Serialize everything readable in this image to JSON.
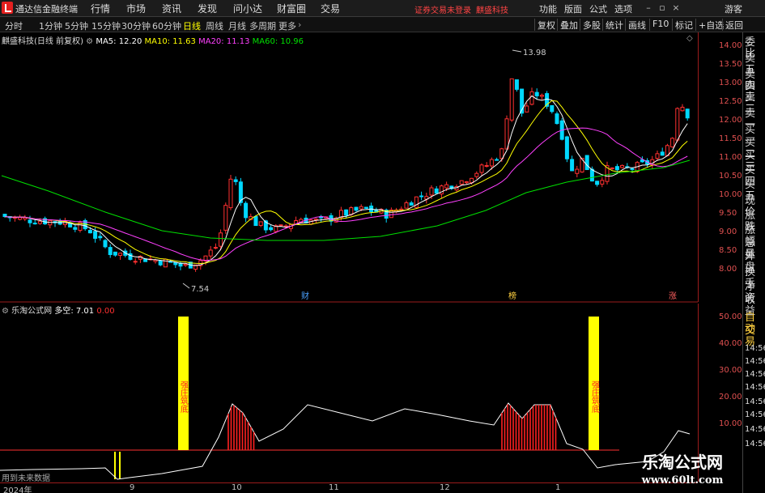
{
  "titlebar": {
    "app_title": "通达信金融终端",
    "menu": [
      "行情",
      "市场",
      "资讯",
      "发现",
      "问小达",
      "财富圈",
      "交易"
    ],
    "login_status": "证券交易未登录",
    "stock": "麒盛科技",
    "right_menu": [
      "功能",
      "版面",
      "公式",
      "选项",
      "游客"
    ],
    "window_buttons": [
      "minimize-icon",
      "restore-icon",
      "close-icon"
    ]
  },
  "toolbar": {
    "periods": [
      "分时",
      "1分钟",
      "5分钟",
      "15分钟",
      "30分钟",
      "60分钟",
      "日线",
      "周线",
      "月线",
      "多周期",
      "更多"
    ],
    "active_period": "日线",
    "right_tools": [
      "复权",
      "叠加",
      "多股",
      "统计",
      "画线",
      "F10",
      "标记",
      "+自选",
      "返回"
    ]
  },
  "chart": {
    "stock_label": "麒盛科技(日线 前复权)",
    "ma": [
      {
        "label": "MA5: 12.20",
        "color": "#ffffff"
      },
      {
        "label": "MA10: 11.63",
        "color": "#ffff00"
      },
      {
        "label": "MA20: 11.13",
        "color": "#ff40ff"
      },
      {
        "label": "MA60: 10.96",
        "color": "#00e000"
      }
    ],
    "high_label": "13.98",
    "low_label": "7.54",
    "markers": [
      "财",
      "榜",
      "涨"
    ],
    "price_ticks": [
      "14.00",
      "13.50",
      "13.00",
      "12.50",
      "12.00",
      "11.50",
      "11.00",
      "10.50",
      "10.00",
      "9.50",
      "9.00",
      "8.50",
      "8.00"
    ]
  },
  "indicator": {
    "title": "乐淘公式网",
    "line_label": "多空: 7.01",
    "zero_label": "0.00",
    "signal_text": "强庄筑底",
    "ticks": [
      "50.00",
      "40.00",
      "30.00",
      "20.00",
      "10.00"
    ],
    "note": "用到未来数据"
  },
  "dates": [
    "2024年",
    "9",
    "10",
    "11",
    "12",
    "1"
  ],
  "sidebar": [
    "委比",
    "卖五",
    "卖四",
    "卖三",
    "卖二",
    "卖一",
    "买一",
    "买二",
    "买三",
    "买四",
    "买五",
    "现价",
    "涨跌",
    "涨幅",
    "总量",
    "外盘",
    "换手",
    "净资",
    "收益",
    "自动",
    "交易",
    "14:56",
    "14:56",
    "14:56",
    "14:56",
    "14:56",
    "14:56",
    "14:56",
    "14:56"
  ],
  "watermark": {
    "line1": "乐淘公式网",
    "line2": "www.60lt.com"
  },
  "colors": {
    "up": "#ff3030",
    "down": "#00d8ff",
    "ma5": "#ffffff",
    "ma10": "#ffff00",
    "ma20": "#ff40ff",
    "ma60": "#00e000",
    "signal": "#ffff00"
  }
}
